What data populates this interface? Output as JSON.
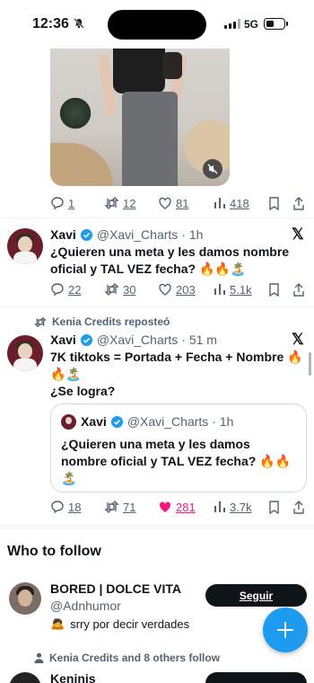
{
  "status_bar": {
    "time": "12:36",
    "network": "5G"
  },
  "tweet_top": {
    "actions": {
      "replies": "1",
      "reposts": "12",
      "likes": "81",
      "views": "418"
    }
  },
  "tweet1": {
    "name": "Xavi",
    "handle": "@Xavi_Charts",
    "time": "· 1h",
    "line1": "¿Quieren una meta y les damos nombre",
    "line2": "oficial y TAL VEZ fecha? 🔥🔥🏝️",
    "actions": {
      "replies": "22",
      "reposts": "30",
      "likes": "203",
      "views": "5.1k"
    }
  },
  "tweet2": {
    "repost_label": "Kenia Credits reposteó",
    "name": "Xavi",
    "handle": "@Xavi_Charts",
    "time": "· 51 m",
    "line1": "7K tiktoks = Portada + Fecha + Nombre 🔥",
    "line2": "🔥🏝️",
    "line3": "¿Se logra?",
    "quote": {
      "name": "Xavi",
      "handle": "@Xavi_Charts",
      "time": "· 1h",
      "line1": "¿Quieren una meta y les damos",
      "line2": "nombre oficial y TAL VEZ fecha? 🔥🔥",
      "line3": "🏝️"
    },
    "actions": {
      "replies": "18",
      "reposts": "71",
      "likes": "281",
      "views": "3.7k"
    }
  },
  "who_to_follow": {
    "title": "Who to follow",
    "suggestion1": {
      "name": "BORED | DOLCE VITA",
      "handle": "@Adnhumor",
      "bio": "srry por decir verdades",
      "bio_emoji": "🙇",
      "button": "Seguir"
    },
    "followers_note": "Kenia Credits and 8 others follow",
    "suggestion2": {
      "name": "Keninis"
    }
  },
  "colors": {
    "accent": "#1d9bf0",
    "like": "#f91880",
    "muted": "#536471",
    "text": "#0f1419"
  }
}
